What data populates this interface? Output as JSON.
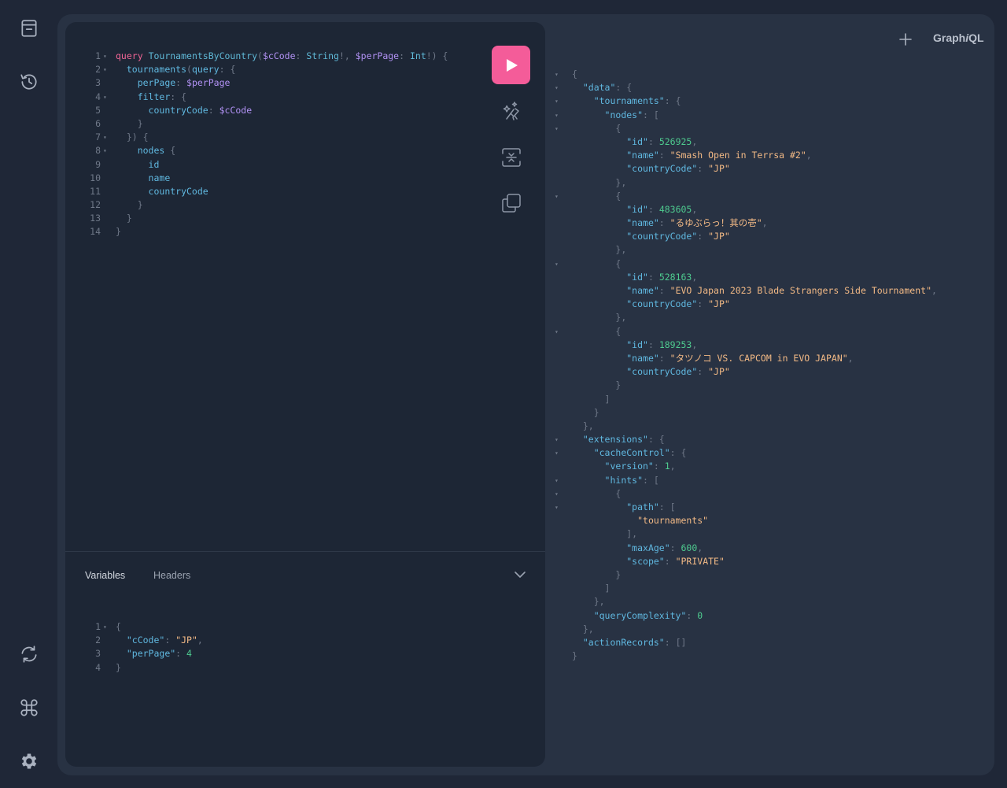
{
  "app": {
    "logo_text": "GraphiQL",
    "logo_prefix": "Graph",
    "logo_italic": "i",
    "logo_suffix": "QL"
  },
  "sidebar": {
    "icons": [
      "docs-icon",
      "history-icon",
      "refetch-schema-icon",
      "shortcuts-icon",
      "settings-icon"
    ]
  },
  "toolbar": {
    "run_icon": "play-icon",
    "prettify_icon": "magic-wand-icon",
    "merge_icon": "merge-fragments-icon",
    "copy_icon": "copy-icon"
  },
  "tabs": {
    "variables": "Variables",
    "headers": "Headers"
  },
  "query_lines": [
    {
      "n": "1",
      "fold": "▾",
      "tokens": [
        [
          "kw",
          "query"
        ],
        [
          "plain",
          " "
        ],
        [
          "def",
          "TournamentsByCountry"
        ],
        [
          "punc",
          "("
        ],
        [
          "var",
          "$cCode"
        ],
        [
          "punc",
          ": "
        ],
        [
          "type",
          "String"
        ],
        [
          "punc",
          "!, "
        ],
        [
          "var",
          "$perPage"
        ],
        [
          "punc",
          ": "
        ],
        [
          "type",
          "Int"
        ],
        [
          "punc",
          "!) {"
        ]
      ]
    },
    {
      "n": "2",
      "fold": "▾",
      "tokens": [
        [
          "plain",
          "  "
        ],
        [
          "fld",
          "tournaments"
        ],
        [
          "punc",
          "("
        ],
        [
          "arg",
          "query"
        ],
        [
          "punc",
          ": {"
        ]
      ]
    },
    {
      "n": "3",
      "fold": "",
      "tokens": [
        [
          "plain",
          "    "
        ],
        [
          "arg",
          "perPage"
        ],
        [
          "punc",
          ": "
        ],
        [
          "var",
          "$perPage"
        ]
      ]
    },
    {
      "n": "4",
      "fold": "▾",
      "tokens": [
        [
          "plain",
          "    "
        ],
        [
          "arg",
          "filter"
        ],
        [
          "punc",
          ": {"
        ]
      ]
    },
    {
      "n": "5",
      "fold": "",
      "tokens": [
        [
          "plain",
          "      "
        ],
        [
          "arg",
          "countryCode"
        ],
        [
          "punc",
          ": "
        ],
        [
          "var",
          "$cCode"
        ]
      ]
    },
    {
      "n": "6",
      "fold": "",
      "tokens": [
        [
          "plain",
          "    "
        ],
        [
          "punc",
          "}"
        ]
      ]
    },
    {
      "n": "7",
      "fold": "▾",
      "tokens": [
        [
          "plain",
          "  "
        ],
        [
          "punc",
          "}) {"
        ]
      ]
    },
    {
      "n": "8",
      "fold": "▾",
      "tokens": [
        [
          "plain",
          "    "
        ],
        [
          "fld",
          "nodes"
        ],
        [
          "punc",
          " {"
        ]
      ]
    },
    {
      "n": "9",
      "fold": "",
      "tokens": [
        [
          "plain",
          "      "
        ],
        [
          "fld",
          "id"
        ]
      ]
    },
    {
      "n": "10",
      "fold": "",
      "tokens": [
        [
          "plain",
          "      "
        ],
        [
          "fld",
          "name"
        ]
      ]
    },
    {
      "n": "11",
      "fold": "",
      "tokens": [
        [
          "plain",
          "      "
        ],
        [
          "fld",
          "countryCode"
        ]
      ]
    },
    {
      "n": "12",
      "fold": "",
      "tokens": [
        [
          "plain",
          "    "
        ],
        [
          "punc",
          "}"
        ]
      ]
    },
    {
      "n": "13",
      "fold": "",
      "tokens": [
        [
          "plain",
          "  "
        ],
        [
          "punc",
          "}"
        ]
      ]
    },
    {
      "n": "14",
      "fold": "",
      "tokens": [
        [
          "punc",
          "}"
        ]
      ]
    }
  ],
  "variables_lines": [
    {
      "n": "1",
      "fold": "▾",
      "tokens": [
        [
          "punc",
          "{"
        ]
      ]
    },
    {
      "n": "2",
      "fold": "",
      "tokens": [
        [
          "plain",
          "  "
        ],
        [
          "key",
          "\"cCode\""
        ],
        [
          "punc",
          ": "
        ],
        [
          "str",
          "\"JP\""
        ],
        [
          "punc",
          ","
        ]
      ]
    },
    {
      "n": "3",
      "fold": "",
      "tokens": [
        [
          "plain",
          "  "
        ],
        [
          "key",
          "\"perPage\""
        ],
        [
          "punc",
          ": "
        ],
        [
          "num",
          "4"
        ]
      ]
    },
    {
      "n": "4",
      "fold": "",
      "tokens": [
        [
          "punc",
          "}"
        ]
      ]
    }
  ],
  "result_lines": [
    {
      "fold": "▾",
      "tokens": [
        [
          "punc",
          "{"
        ]
      ]
    },
    {
      "fold": "▾",
      "tokens": [
        [
          "plain",
          "  "
        ],
        [
          "key",
          "\"data\""
        ],
        [
          "punc",
          ": {"
        ]
      ]
    },
    {
      "fold": "▾",
      "tokens": [
        [
          "plain",
          "    "
        ],
        [
          "key",
          "\"tournaments\""
        ],
        [
          "punc",
          ": {"
        ]
      ]
    },
    {
      "fold": "▾",
      "tokens": [
        [
          "plain",
          "      "
        ],
        [
          "key",
          "\"nodes\""
        ],
        [
          "punc",
          ": ["
        ]
      ]
    },
    {
      "fold": "▾",
      "tokens": [
        [
          "plain",
          "        "
        ],
        [
          "punc",
          "{"
        ]
      ]
    },
    {
      "fold": "",
      "tokens": [
        [
          "plain",
          "          "
        ],
        [
          "key",
          "\"id\""
        ],
        [
          "punc",
          ": "
        ],
        [
          "num",
          "526925"
        ],
        [
          "punc",
          ","
        ]
      ]
    },
    {
      "fold": "",
      "tokens": [
        [
          "plain",
          "          "
        ],
        [
          "key",
          "\"name\""
        ],
        [
          "punc",
          ": "
        ],
        [
          "str",
          "\"Smash Open in Terrsa #2\""
        ],
        [
          "punc",
          ","
        ]
      ]
    },
    {
      "fold": "",
      "tokens": [
        [
          "plain",
          "          "
        ],
        [
          "key",
          "\"countryCode\""
        ],
        [
          "punc",
          ": "
        ],
        [
          "str",
          "\"JP\""
        ]
      ]
    },
    {
      "fold": "",
      "tokens": [
        [
          "plain",
          "        "
        ],
        [
          "punc",
          "},"
        ]
      ]
    },
    {
      "fold": "▾",
      "tokens": [
        [
          "plain",
          "        "
        ],
        [
          "punc",
          "{"
        ]
      ]
    },
    {
      "fold": "",
      "tokens": [
        [
          "plain",
          "          "
        ],
        [
          "key",
          "\"id\""
        ],
        [
          "punc",
          ": "
        ],
        [
          "num",
          "483605"
        ],
        [
          "punc",
          ","
        ]
      ]
    },
    {
      "fold": "",
      "tokens": [
        [
          "plain",
          "          "
        ],
        [
          "key",
          "\"name\""
        ],
        [
          "punc",
          ": "
        ],
        [
          "str",
          "\"るゆぶらっ！其の壱\""
        ],
        [
          "punc",
          ","
        ]
      ]
    },
    {
      "fold": "",
      "tokens": [
        [
          "plain",
          "          "
        ],
        [
          "key",
          "\"countryCode\""
        ],
        [
          "punc",
          ": "
        ],
        [
          "str",
          "\"JP\""
        ]
      ]
    },
    {
      "fold": "",
      "tokens": [
        [
          "plain",
          "        "
        ],
        [
          "punc",
          "},"
        ]
      ]
    },
    {
      "fold": "▾",
      "tokens": [
        [
          "plain",
          "        "
        ],
        [
          "punc",
          "{"
        ]
      ]
    },
    {
      "fold": "",
      "tokens": [
        [
          "plain",
          "          "
        ],
        [
          "key",
          "\"id\""
        ],
        [
          "punc",
          ": "
        ],
        [
          "num",
          "528163"
        ],
        [
          "punc",
          ","
        ]
      ]
    },
    {
      "fold": "",
      "tokens": [
        [
          "plain",
          "          "
        ],
        [
          "key",
          "\"name\""
        ],
        [
          "punc",
          ": "
        ],
        [
          "str",
          "\"EVO Japan 2023 Blade Strangers Side Tournament\""
        ],
        [
          "punc",
          ","
        ]
      ]
    },
    {
      "fold": "",
      "tokens": [
        [
          "plain",
          "          "
        ],
        [
          "key",
          "\"countryCode\""
        ],
        [
          "punc",
          ": "
        ],
        [
          "str",
          "\"JP\""
        ]
      ]
    },
    {
      "fold": "",
      "tokens": [
        [
          "plain",
          "        "
        ],
        [
          "punc",
          "},"
        ]
      ]
    },
    {
      "fold": "▾",
      "tokens": [
        [
          "plain",
          "        "
        ],
        [
          "punc",
          "{"
        ]
      ]
    },
    {
      "fold": "",
      "tokens": [
        [
          "plain",
          "          "
        ],
        [
          "key",
          "\"id\""
        ],
        [
          "punc",
          ": "
        ],
        [
          "num",
          "189253"
        ],
        [
          "punc",
          ","
        ]
      ]
    },
    {
      "fold": "",
      "tokens": [
        [
          "plain",
          "          "
        ],
        [
          "key",
          "\"name\""
        ],
        [
          "punc",
          ": "
        ],
        [
          "str",
          "\"タツノコ VS. CAPCOM in EVO JAPAN\""
        ],
        [
          "punc",
          ","
        ]
      ]
    },
    {
      "fold": "",
      "tokens": [
        [
          "plain",
          "          "
        ],
        [
          "key",
          "\"countryCode\""
        ],
        [
          "punc",
          ": "
        ],
        [
          "str",
          "\"JP\""
        ]
      ]
    },
    {
      "fold": "",
      "tokens": [
        [
          "plain",
          "        "
        ],
        [
          "punc",
          "}"
        ]
      ]
    },
    {
      "fold": "",
      "tokens": [
        [
          "plain",
          "      "
        ],
        [
          "punc",
          "]"
        ]
      ]
    },
    {
      "fold": "",
      "tokens": [
        [
          "plain",
          "    "
        ],
        [
          "punc",
          "}"
        ]
      ]
    },
    {
      "fold": "",
      "tokens": [
        [
          "plain",
          "  "
        ],
        [
          "punc",
          "},"
        ]
      ]
    },
    {
      "fold": "▾",
      "tokens": [
        [
          "plain",
          "  "
        ],
        [
          "key",
          "\"extensions\""
        ],
        [
          "punc",
          ": {"
        ]
      ]
    },
    {
      "fold": "▾",
      "tokens": [
        [
          "plain",
          "    "
        ],
        [
          "key",
          "\"cacheControl\""
        ],
        [
          "punc",
          ": {"
        ]
      ]
    },
    {
      "fold": "",
      "tokens": [
        [
          "plain",
          "      "
        ],
        [
          "key",
          "\"version\""
        ],
        [
          "punc",
          ": "
        ],
        [
          "num",
          "1"
        ],
        [
          "punc",
          ","
        ]
      ]
    },
    {
      "fold": "▾",
      "tokens": [
        [
          "plain",
          "      "
        ],
        [
          "key",
          "\"hints\""
        ],
        [
          "punc",
          ": ["
        ]
      ]
    },
    {
      "fold": "▾",
      "tokens": [
        [
          "plain",
          "        "
        ],
        [
          "punc",
          "{"
        ]
      ]
    },
    {
      "fold": "▾",
      "tokens": [
        [
          "plain",
          "          "
        ],
        [
          "key",
          "\"path\""
        ],
        [
          "punc",
          ": ["
        ]
      ]
    },
    {
      "fold": "",
      "tokens": [
        [
          "plain",
          "            "
        ],
        [
          "str",
          "\"tournaments\""
        ]
      ]
    },
    {
      "fold": "",
      "tokens": [
        [
          "plain",
          "          "
        ],
        [
          "punc",
          "],"
        ]
      ]
    },
    {
      "fold": "",
      "tokens": [
        [
          "plain",
          "          "
        ],
        [
          "key",
          "\"maxAge\""
        ],
        [
          "punc",
          ": "
        ],
        [
          "num",
          "600"
        ],
        [
          "punc",
          ","
        ]
      ]
    },
    {
      "fold": "",
      "tokens": [
        [
          "plain",
          "          "
        ],
        [
          "key",
          "\"scope\""
        ],
        [
          "punc",
          ": "
        ],
        [
          "str",
          "\"PRIVATE\""
        ]
      ]
    },
    {
      "fold": "",
      "tokens": [
        [
          "plain",
          "        "
        ],
        [
          "punc",
          "}"
        ]
      ]
    },
    {
      "fold": "",
      "tokens": [
        [
          "plain",
          "      "
        ],
        [
          "punc",
          "]"
        ]
      ]
    },
    {
      "fold": "",
      "tokens": [
        [
          "plain",
          "    "
        ],
        [
          "punc",
          "},"
        ]
      ]
    },
    {
      "fold": "",
      "tokens": [
        [
          "plain",
          "    "
        ],
        [
          "key",
          "\"queryComplexity\""
        ],
        [
          "punc",
          ": "
        ],
        [
          "num",
          "0"
        ]
      ]
    },
    {
      "fold": "",
      "tokens": [
        [
          "plain",
          "  "
        ],
        [
          "punc",
          "},"
        ]
      ]
    },
    {
      "fold": "",
      "tokens": [
        [
          "plain",
          "  "
        ],
        [
          "key",
          "\"actionRecords\""
        ],
        [
          "punc",
          ": []"
        ]
      ]
    },
    {
      "fold": "",
      "tokens": [
        [
          "punc",
          "}"
        ]
      ]
    }
  ]
}
